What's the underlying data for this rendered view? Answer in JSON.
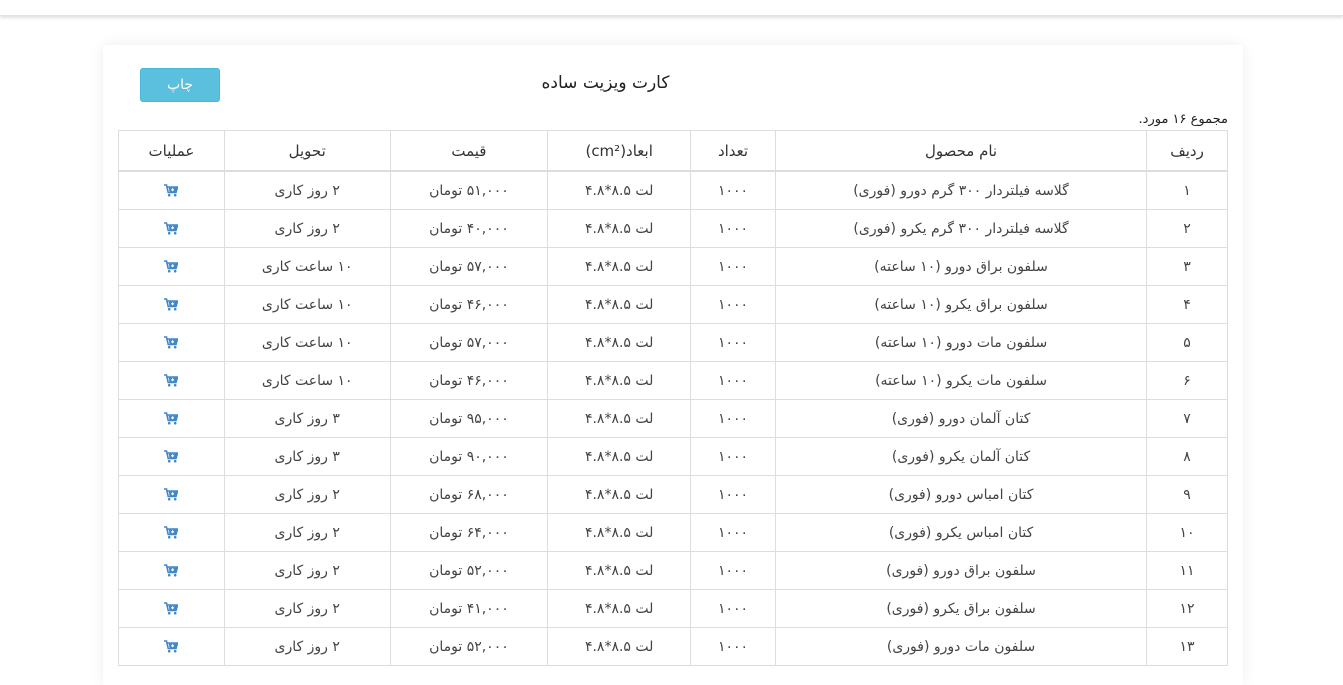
{
  "page": {
    "title": "کارت ویزیت ساده",
    "print_label": "چاپ",
    "total_text": "مجموع ۱۶ مورد."
  },
  "table": {
    "headers": [
      "ردیف",
      "نام محصول",
      "تعداد",
      "ابعاد(cm²)",
      "قیمت",
      "تحویل",
      "عملیات"
    ],
    "rows": [
      {
        "index": "۱",
        "name": "گلاسه فیلتردار ۳۰۰ گرم دورو (فوری)",
        "qty": "۱۰۰۰",
        "size": "لت ۸.۵*۴.۸",
        "price": "۵۱,۰۰۰ تومان",
        "delivery": "۲ روز کاری"
      },
      {
        "index": "۲",
        "name": "گلاسه فیلتردار ۳۰۰ گرم یکرو (فوری)",
        "qty": "۱۰۰۰",
        "size": "لت ۸.۵*۴.۸",
        "price": "۴۰,۰۰۰ تومان",
        "delivery": "۲ روز کاری"
      },
      {
        "index": "۳",
        "name": "سلفون براق دورو (۱۰ ساعته)",
        "qty": "۱۰۰۰",
        "size": "لت ۸.۵*۴.۸",
        "price": "۵۷,۰۰۰ تومان",
        "delivery": "۱۰ ساعت کاری"
      },
      {
        "index": "۴",
        "name": "سلفون براق یکرو (۱۰ ساعته)",
        "qty": "۱۰۰۰",
        "size": "لت ۸.۵*۴.۸",
        "price": "۴۶,۰۰۰ تومان",
        "delivery": "۱۰ ساعت کاری"
      },
      {
        "index": "۵",
        "name": "سلفون مات دورو (۱۰ ساعته)",
        "qty": "۱۰۰۰",
        "size": "لت ۸.۵*۴.۸",
        "price": "۵۷,۰۰۰ تومان",
        "delivery": "۱۰ ساعت کاری"
      },
      {
        "index": "۶",
        "name": "سلفون مات یکرو (۱۰ ساعته)",
        "qty": "۱۰۰۰",
        "size": "لت ۸.۵*۴.۸",
        "price": "۴۶,۰۰۰ تومان",
        "delivery": "۱۰ ساعت کاری"
      },
      {
        "index": "۷",
        "name": "کتان آلمان دورو (فوری)",
        "qty": "۱۰۰۰",
        "size": "لت ۸.۵*۴.۸",
        "price": "۹۵,۰۰۰ تومان",
        "delivery": "۳ روز کاری"
      },
      {
        "index": "۸",
        "name": "کتان آلمان یکرو (فوری)",
        "qty": "۱۰۰۰",
        "size": "لت ۸.۵*۴.۸",
        "price": "۹۰,۰۰۰ تومان",
        "delivery": "۳ روز کاری"
      },
      {
        "index": "۹",
        "name": "کتان امباس دورو (فوری)",
        "qty": "۱۰۰۰",
        "size": "لت ۸.۵*۴.۸",
        "price": "۶۸,۰۰۰ تومان",
        "delivery": "۲ روز کاری"
      },
      {
        "index": "۱۰",
        "name": "کتان امباس یکرو (فوری)",
        "qty": "۱۰۰۰",
        "size": "لت ۸.۵*۴.۸",
        "price": "۶۴,۰۰۰ تومان",
        "delivery": "۲ روز کاری"
      },
      {
        "index": "۱۱",
        "name": "سلفون براق دورو (فوری)",
        "qty": "۱۰۰۰",
        "size": "لت ۸.۵*۴.۸",
        "price": "۵۲,۰۰۰ تومان",
        "delivery": "۲ روز کاری"
      },
      {
        "index": "۱۲",
        "name": "سلفون براق یکرو (فوری)",
        "qty": "۱۰۰۰",
        "size": "لت ۸.۵*۴.۸",
        "price": "۴۱,۰۰۰ تومان",
        "delivery": "۲ روز کاری"
      },
      {
        "index": "۱۳",
        "name": "سلفون مات دورو (فوری)",
        "qty": "۱۰۰۰",
        "size": "لت ۸.۵*۴.۸",
        "price": "۵۲,۰۰۰ تومان",
        "delivery": "۲ روز کاری"
      }
    ],
    "action_icon": "cart-plus-icon"
  },
  "colors": {
    "print_button": "#5bc0de",
    "cart_icon": "#3f86c8"
  }
}
